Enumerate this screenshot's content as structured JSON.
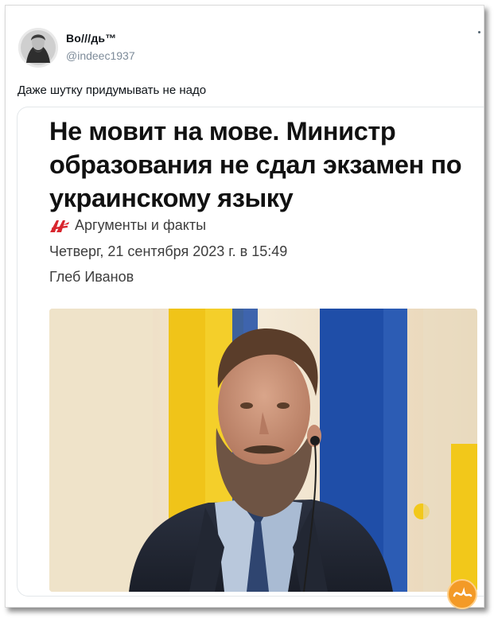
{
  "tweet": {
    "author_name": "Во///дь™",
    "author_handle": "@indeec1937",
    "text": "Даже шутку придумывать не надо"
  },
  "card": {
    "headline": "Не мовит на мове. Министр образования не сдал экзамен по украинскому языку",
    "source_name": "Аргументы и факты",
    "date": "Четверг, 21 сентября 2023 г. в 15:49",
    "author": "Глеб Иванов"
  },
  "icons": {
    "avatar": "avatar-portrait",
    "source": "aif-logo-icon",
    "more": "more-options-icon",
    "watermark": "watermark-logo"
  },
  "colors": {
    "text_primary": "#0f1419",
    "text_secondary": "#7d8b99",
    "aif_red": "#d8262e",
    "flag_blue": "#1f4ea8",
    "flag_yellow": "#f2c81a",
    "watermark_orange": "#f39a27"
  }
}
